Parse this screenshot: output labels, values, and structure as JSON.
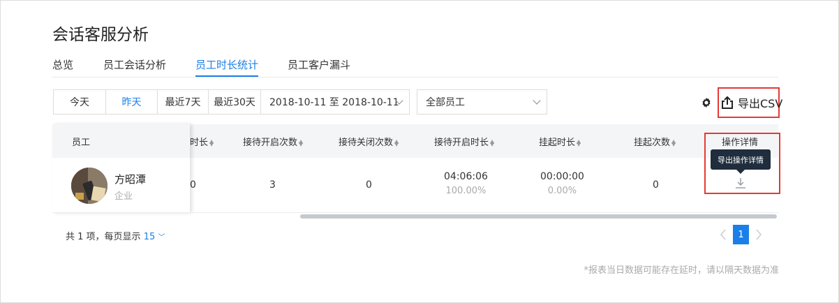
{
  "page": {
    "title": "会话客服分析"
  },
  "tabs": [
    {
      "label": "总览"
    },
    {
      "label": "员工会话分析"
    },
    {
      "label": "员工时长统计",
      "active": true
    },
    {
      "label": "员工客户漏斗"
    }
  ],
  "filters": {
    "date_buttons": [
      "今天",
      "昨天",
      "最近7天",
      "最近30天"
    ],
    "active_date": "昨天",
    "date_range": "2018-10-11 至 2018-10-11",
    "employee_select": "全部员工"
  },
  "toolbar": {
    "export_label": "导出CSV"
  },
  "table": {
    "fixed_header": "员工",
    "partial_header": "时长",
    "headers": [
      "接待开启次数",
      "接待关闭次数",
      "接待开启时长",
      "挂起时长",
      "挂起次数",
      "操作详情"
    ],
    "rows": [
      {
        "name": "方昭潭",
        "type": "企业",
        "partial_value": "0",
        "open_count": "3",
        "close_count": "0",
        "open_duration": "04:06:06",
        "open_pct": "100.00%",
        "hold_duration": "00:00:00",
        "hold_pct": "0.00%",
        "hold_count": "0"
      }
    ],
    "detail_tooltip": "导出操作详情"
  },
  "pagination": {
    "summary_prefix": "共 1 项，每页显示",
    "page_size": "15",
    "current_page": "1"
  },
  "note": "*报表当日数据可能存在延时，请以隔天数据为准",
  "colors": {
    "accent": "#1a7fe8",
    "highlight": "#e53935",
    "tooltip_bg": "#1f2d3d"
  }
}
